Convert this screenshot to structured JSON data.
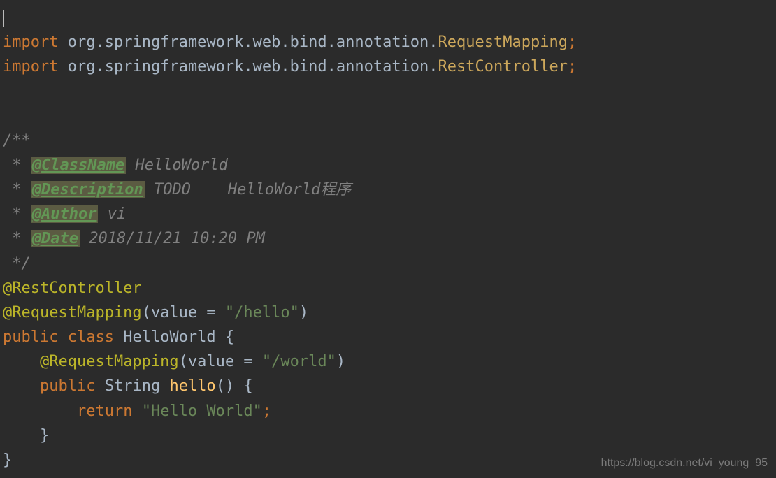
{
  "imports": [
    {
      "keyword": "import",
      "path": "org.springframework.web.bind.annotation.",
      "className": "RequestMapping"
    },
    {
      "keyword": "import",
      "path": "org.springframework.web.bind.annotation.",
      "className": "RestController"
    }
  ],
  "javadoc": {
    "open": "/**",
    "star": " * ",
    "tags": [
      {
        "tag": "@ClassName",
        "text": " HelloWorld"
      },
      {
        "tag": "@Description",
        "text": " TODO    HelloWorld程序"
      },
      {
        "tag": "@Author",
        "text": " vi"
      },
      {
        "tag": "@Date",
        "text": " 2018/11/21 10:20 PM"
      }
    ],
    "close": " */"
  },
  "annotation1": "@RestController",
  "annotation2": {
    "name": "@RequestMapping",
    "paramName": "value",
    "eq": " = ",
    "paramValue": "\"/hello\""
  },
  "classDecl": {
    "kw_public": "public",
    "kw_class": "class",
    "name": "HelloWorld"
  },
  "methodAnnotation": {
    "name": "@RequestMapping",
    "paramName": "value",
    "eq": " = ",
    "paramValue": "\"/world\""
  },
  "methodDecl": {
    "kw_public": "public",
    "returnType": "String",
    "name": "hello"
  },
  "returnStmt": {
    "kw_return": "return",
    "value": "\"Hello World\""
  },
  "watermark": "https://blog.csdn.net/vi_young_95"
}
